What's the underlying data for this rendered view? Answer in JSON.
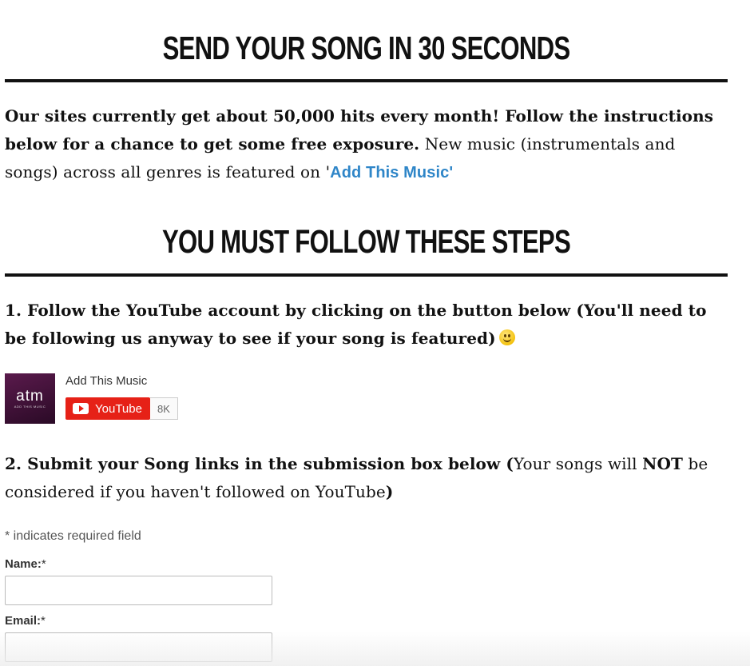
{
  "headings": {
    "send_title": "SEND YOUR SONG IN 30 SECONDS",
    "steps_title": "YOU MUST FOLLOW THESE STEPS"
  },
  "intro": {
    "bold_text": "Our sites currently get about 50,000 hits every month! Follow the instructions below for a chance to get some free exposure.",
    "normal_text": " New music (instrumentals and songs) across all genres is featured on '",
    "link_text": "Add This Music",
    "closing_quote": "'"
  },
  "step1": {
    "text": "1. Follow the YouTube account by clicking on the button below (You'll need to be following us anyway to see if your song is featured)",
    "emoji_icon": "smiling-face-icon"
  },
  "youtube_widget": {
    "avatar_mark": "atm",
    "avatar_subtext": "ADD THIS MUSIC",
    "channel_name": "Add This Music",
    "button_label": "YouTube",
    "subscriber_count": "8K",
    "brand_color": "#e62117"
  },
  "step2": {
    "bold_start": "2. Submit your Song links in the submission box below (",
    "normal_1": "Your songs will ",
    "bold_not": "NOT",
    "normal_2": " be considered if you haven't followed on YouTube",
    "bold_end": ")"
  },
  "form": {
    "required_note": "* indicates required field",
    "name_label": "Name:",
    "email_label": "Email:",
    "required_star": "*",
    "name_value": "",
    "email_value": ""
  },
  "colors": {
    "link": "#2f86c8",
    "text": "#111111"
  }
}
